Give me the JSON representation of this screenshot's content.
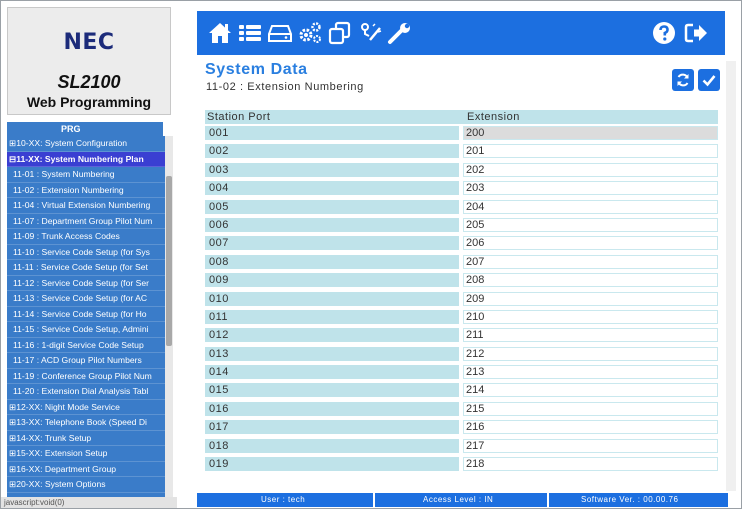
{
  "branding": {
    "company": "NEC",
    "product": "SL2100",
    "subtitle": "Web Programming"
  },
  "nav": {
    "header": "PRG",
    "items": [
      {
        "label": "⊞10-XX: System Configuration",
        "level": 0,
        "selected": false
      },
      {
        "label": "⊟11-XX: System Numbering Plan",
        "level": 0,
        "selected": true
      },
      {
        "label": "11-01 : System Numbering",
        "level": 1,
        "selected": false
      },
      {
        "label": "11-02 : Extension Numbering",
        "level": 1,
        "selected": false
      },
      {
        "label": "11-04 : Virtual Extension Numbering",
        "level": 1,
        "selected": false
      },
      {
        "label": "11-07 : Department Group Pilot Num",
        "level": 1,
        "selected": false
      },
      {
        "label": "11-09 : Trunk Access Codes",
        "level": 1,
        "selected": false
      },
      {
        "label": "11-10 : Service Code Setup (for Sys",
        "level": 1,
        "selected": false
      },
      {
        "label": "11-11 : Service Code Setup (for Set",
        "level": 1,
        "selected": false
      },
      {
        "label": "11-12 : Service Code Setup (for Ser",
        "level": 1,
        "selected": false
      },
      {
        "label": "11-13 : Service Code Setup (for AC",
        "level": 1,
        "selected": false
      },
      {
        "label": "11-14 : Service Code Setup (for Ho",
        "level": 1,
        "selected": false
      },
      {
        "label": "11-15 : Service Code Setup, Admini",
        "level": 1,
        "selected": false
      },
      {
        "label": "11-16 : 1-digit Service Code Setup",
        "level": 1,
        "selected": false
      },
      {
        "label": "11-17 : ACD Group Pilot Numbers",
        "level": 1,
        "selected": false
      },
      {
        "label": "11-19 : Conference Group Pilot Num",
        "level": 1,
        "selected": false
      },
      {
        "label": "11-20 : Extension Dial Analysis Tabl",
        "level": 1,
        "selected": false
      },
      {
        "label": "⊞12-XX: Night Mode Service",
        "level": 0,
        "selected": false
      },
      {
        "label": "⊞13-XX: Telephone Book (Speed Di",
        "level": 0,
        "selected": false
      },
      {
        "label": "⊞14-XX: Trunk Setup",
        "level": 0,
        "selected": false
      },
      {
        "label": "⊞15-XX: Extension Setup",
        "level": 0,
        "selected": false
      },
      {
        "label": "⊞16-XX: Department Group",
        "level": 0,
        "selected": false
      },
      {
        "label": "⊞20-XX: System Options",
        "level": 0,
        "selected": false
      }
    ]
  },
  "status_text": "javascript:void(0)",
  "toolbar": {
    "icons": [
      "home-icon",
      "list-icon",
      "storage-icon",
      "gears-icon",
      "copy-icon",
      "wizard-icon",
      "wrench-icon",
      "help-icon",
      "logout-icon"
    ]
  },
  "page": {
    "title": "System Data",
    "subtitle": "11-02 : Extension Numbering"
  },
  "table": {
    "columns": [
      "Station Port",
      "Extension"
    ],
    "rows": [
      {
        "port": "001",
        "ext": "200"
      },
      {
        "port": "002",
        "ext": "201"
      },
      {
        "port": "003",
        "ext": "202"
      },
      {
        "port": "004",
        "ext": "203"
      },
      {
        "port": "005",
        "ext": "204"
      },
      {
        "port": "006",
        "ext": "205"
      },
      {
        "port": "007",
        "ext": "206"
      },
      {
        "port": "008",
        "ext": "207"
      },
      {
        "port": "009",
        "ext": "208"
      },
      {
        "port": "010",
        "ext": "209"
      },
      {
        "port": "011",
        "ext": "210"
      },
      {
        "port": "012",
        "ext": "211"
      },
      {
        "port": "013",
        "ext": "212"
      },
      {
        "port": "014",
        "ext": "213"
      },
      {
        "port": "015",
        "ext": "214"
      },
      {
        "port": "016",
        "ext": "215"
      },
      {
        "port": "017",
        "ext": "216"
      },
      {
        "port": "018",
        "ext": "217"
      },
      {
        "port": "019",
        "ext": "218"
      }
    ]
  },
  "footer": {
    "user": "User : tech",
    "access": "Access Level : IN",
    "software": "Software Ver. : 00.00.76"
  },
  "colors": {
    "toolbar": "#1c6fe0",
    "nav_bg": "#3a7cc9",
    "nav_selected": "#3a3fd2",
    "title": "#2a7fe0",
    "cell": "#bfe3ea"
  }
}
